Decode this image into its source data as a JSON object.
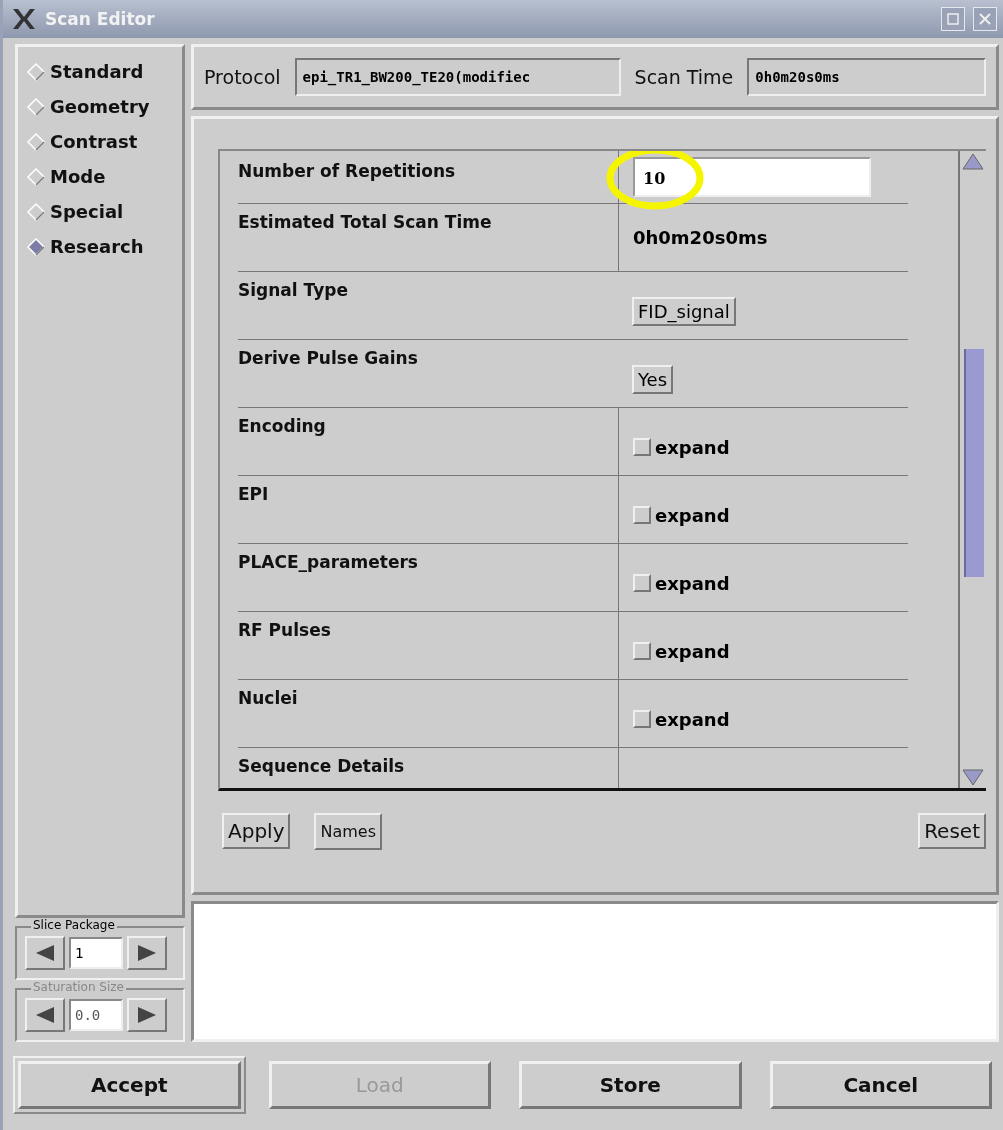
{
  "window": {
    "title": "Scan Editor"
  },
  "sidebar": {
    "items": [
      {
        "label": "Standard",
        "selected": false
      },
      {
        "label": "Geometry",
        "selected": false
      },
      {
        "label": "Contrast",
        "selected": false
      },
      {
        "label": "Mode",
        "selected": false
      },
      {
        "label": "Special",
        "selected": false
      },
      {
        "label": "Research",
        "selected": true
      }
    ]
  },
  "header": {
    "protocol_label": "Protocol",
    "protocol": "epi_TR1_BW200_TE20(modifiec",
    "scan_time_label": "Scan Time",
    "scan_time": "0h0m20s0ms"
  },
  "parameters": [
    {
      "kind": "input",
      "label": "Number of Repetitions",
      "value": "10",
      "highlighted": true
    },
    {
      "kind": "text",
      "label": "Estimated Total Scan Time",
      "value": "0h0m20s0ms"
    },
    {
      "kind": "button",
      "label": "Signal Type",
      "value": "FID_signal"
    },
    {
      "kind": "button",
      "label": "Derive Pulse Gains",
      "value": "Yes"
    },
    {
      "kind": "expand",
      "label": "Encoding",
      "value": "expand",
      "checked": false
    },
    {
      "kind": "expand",
      "label": "EPI",
      "value": "expand",
      "checked": false
    },
    {
      "kind": "expand",
      "label": "PLACE_parameters",
      "value": "expand",
      "checked": false
    },
    {
      "kind": "expand",
      "label": "RF Pulses",
      "value": "expand",
      "checked": false
    },
    {
      "kind": "expand",
      "label": "Nuclei",
      "value": "expand",
      "checked": false
    },
    {
      "kind": "cut",
      "label": "Sequence Details"
    }
  ],
  "panel_buttons": [
    "Apply",
    "Names",
    "Reset"
  ],
  "spinners": [
    {
      "label": "Slice Package",
      "value": "1",
      "disabled": false
    },
    {
      "label": "Saturation Size",
      "value": "0.0",
      "disabled": true
    }
  ],
  "footer_buttons": [
    {
      "label": "Accept",
      "disabled": false
    },
    {
      "label": "Load",
      "disabled": true
    },
    {
      "label": "Store",
      "disabled": false
    },
    {
      "label": "Cancel",
      "disabled": false
    }
  ]
}
